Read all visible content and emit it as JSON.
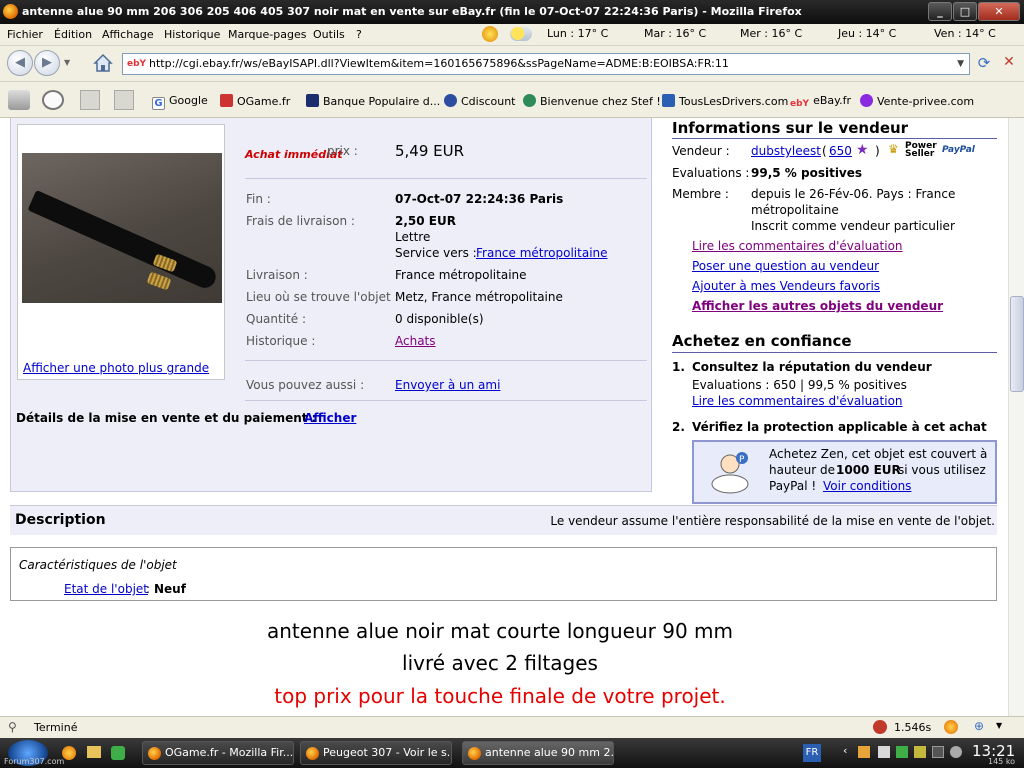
{
  "window": {
    "title": "antenne alue 90 mm 206 306 205 406 405 307 noir mat en vente sur eBay.fr (fin le 07-Oct-07 22:24:36 Paris) - Mozilla Firefox"
  },
  "menu": {
    "items": [
      "Fichier",
      "Édition",
      "Affichage",
      "Historique",
      "Marque-pages",
      "Outils",
      "?"
    ]
  },
  "weather": [
    {
      "label": "Lun : 17° C",
      "icon": "partly-cloudy-icon"
    },
    {
      "label": "Mar : 16° C",
      "icon": "partly-cloudy-icon"
    },
    {
      "label": "Mer : 16° C",
      "icon": "cloudy-icon"
    },
    {
      "label": "Jeu : 14° C",
      "icon": "partly-cloudy-icon"
    },
    {
      "label": "Ven : 14° C",
      "icon": "partly-cloudy-icon"
    }
  ],
  "nav": {
    "url": "http://cgi.ebay.fr/ws/eBayISAPI.dll?ViewItem&item=160165675896&ssPageName=ADME:B:EOIBSA:FR:11",
    "favicon": "ebY"
  },
  "bookmarks": [
    "Google",
    "OGame.fr",
    "Banque Populaire d...",
    "Cdiscount",
    "Bienvenue chez Stef !",
    "TousLesDrivers.com",
    "eBay.fr",
    "Vente-privee.com"
  ],
  "item": {
    "buy_now_logo": "Achat immédiat",
    "price_label": "prix :",
    "price": "5,49 EUR",
    "enlarge_photo": "Afficher une photo plus grande",
    "rows": [
      {
        "label": "Fin :",
        "value": "07-Oct-07 22:24:36 Paris"
      },
      {
        "label": "Frais de livraison :",
        "value": "2,50 EUR"
      },
      {
        "label": "Livraison :",
        "value": "France métropolitaine"
      },
      {
        "label": "Lieu où se trouve l'objet :",
        "value": "Metz, France métropolitaine"
      },
      {
        "label": "Quantité :",
        "value": "0 disponible(s)"
      },
      {
        "label": "Historique :",
        "value": "Achats"
      },
      {
        "label": "Vous pouvez aussi :",
        "value": "Envoyer à un ami"
      }
    ],
    "shipping_method": "Lettre",
    "service_label": "Service vers :",
    "service_link": "France métropolitaine",
    "details_label": "Détails de la mise en vente et du paiement :",
    "details_link": "Afficher"
  },
  "seller": {
    "heading": "Informations sur le vendeur",
    "vendor_label": "Vendeur :",
    "vendor_name": "dubstyleest",
    "feedback_open": "(",
    "feedback_count": "650",
    "feedback_close": ")",
    "power_seller": "Power Seller",
    "eval_label": "Evaluations :",
    "eval_value": "99,5 % positives",
    "member_label": "Membre :",
    "member_line1": "depuis le 26-Fév-06. Pays : France",
    "member_line2": "métropolitaine",
    "member_line3": "Inscrit comme vendeur particulier",
    "links": [
      "Lire les commentaires d'évaluation",
      "Poser une question au vendeur",
      "Ajouter à mes Vendeurs favoris",
      "Afficher les autres objets du vendeur"
    ]
  },
  "confidence": {
    "heading": "Achetez en confiance",
    "step1_num": "1.",
    "step1_title": "Consultez la réputation du vendeur",
    "step1_text": "Evaluations : 650 | 99,5 % positives",
    "step1_link": "Lire les commentaires d'évaluation",
    "step2_num": "2.",
    "step2_title": "Vérifiez la protection applicable à cet achat",
    "zen_line1": "Achetez Zen, cet objet est couvert à",
    "zen_line2a": "hauteur de",
    "zen_amount": "1000 EUR",
    "zen_line2b": "si vous utilisez",
    "zen_line3": "PayPal !",
    "zen_link": "Voir conditions"
  },
  "description": {
    "heading": "Description",
    "responsibility": "Le vendeur assume l'entière responsabilité de la mise en vente de l'objet.",
    "char_title": "Caractéristiques de l'objet",
    "state_label": "Etat de l'objet",
    "state_colon": ":",
    "state_value": "Neuf",
    "line1": "antenne alue noir mat courte longueur 90 mm",
    "line2": "livré avec 2 filtages",
    "line3": "top prix pour la touche finale de votre projet."
  },
  "status": {
    "text": "Terminé",
    "time": "1.546s"
  },
  "taskbar": {
    "tasks": [
      "OGame.fr - Mozilla Fir...",
      "Peugeot 307 - Voir le s...",
      "antenne alue 90 mm 2..."
    ],
    "lang": "FR",
    "clock": "13:21",
    "watermark": "Forum307.com",
    "size": "145 ko"
  },
  "colors": {
    "link": "#0000cc",
    "visited": "#800080",
    "item_bg": "#eeeef8",
    "accent_red": "#e60000"
  }
}
